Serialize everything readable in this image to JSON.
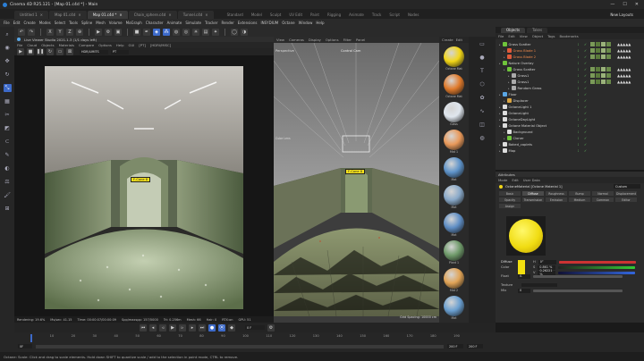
{
  "window": {
    "title": "Cinema 4D R25.121 - [Map 01.c4d *] - Main",
    "controls": [
      "—",
      "☐",
      "✕"
    ]
  },
  "doc_tabs": [
    {
      "label": "Untitled 1",
      "active": false
    },
    {
      "label": "Map 01.c4d",
      "active": false
    },
    {
      "label": "Map 01.c4d *",
      "active": true
    },
    {
      "label": "Chain_sphere.c4d",
      "active": false
    },
    {
      "label": "Tunnel.c4d",
      "active": false
    }
  ],
  "layouts": [
    "Standard",
    "Model",
    "Sculpt",
    "UV Edit",
    "Paint",
    "Rigging",
    "Animate",
    "Track",
    "Script",
    "Nodes"
  ],
  "new_layouts": "New Layouts",
  "menu": [
    "File",
    "Edit",
    "Create",
    "Modes",
    "Select",
    "Tools",
    "Spline",
    "Mesh",
    "Volume",
    "MoGraph",
    "Character",
    "Animate",
    "Simulate",
    "Tracker",
    "Render",
    "Extensions",
    "INSYDIUM",
    "Octane",
    "Window",
    "Help"
  ],
  "live_viewer": {
    "title": "Live Viewer Studio 2021.1.3 (1/1 days left)",
    "menu": [
      "File",
      "Cloud",
      "Objects",
      "Materials",
      "Compare",
      "Options",
      "Help",
      "GUI",
      "[PT]",
      "[HDRI/MISC]"
    ],
    "mode": "HDR/LIMITS",
    "mode2": "PT",
    "label": "F-Cone 8",
    "status": [
      "Rendering: 19.6%",
      "Ms/sec: 41.15",
      "Time: 00:00:07/00:00:09",
      "Spp/maxspp: 157/5000",
      "Tri: 0.256m",
      "Mesh: 66",
      "Hair: 0",
      "RTX:on",
      "GPU: 51"
    ]
  },
  "viewport": {
    "menu": [
      "View",
      "Cameras",
      "Display",
      "Options",
      "Filter",
      "Panel"
    ],
    "camera": "Perspective",
    "camera_name": "Control Cam",
    "label": "F-Cone 8",
    "grid": "Grid Spacing: 10000 cm",
    "side": "Cube Lens"
  },
  "materials": {
    "menu": [
      "Create",
      "Edit"
    ],
    "items": [
      {
        "name": "Octane Mat",
        "color": "#f2d617"
      },
      {
        "name": "Octane Mat",
        "color": "#e07a2b"
      },
      {
        "name": "Glass",
        "color": "#dfe6ee"
      },
      {
        "name": "Mat 1",
        "color": "#e9995a"
      },
      {
        "name": "Mat",
        "color": "#5e93c9"
      },
      {
        "name": "Mat",
        "color": "#89a9c9"
      },
      {
        "name": "Mat",
        "color": "#5f8ec5"
      },
      {
        "name": "Plant 1",
        "color": "#6f9a6a"
      },
      {
        "name": "Mat 2",
        "color": "#e0a356"
      },
      {
        "name": "Mat",
        "color": "#6a9fd0"
      },
      {
        "name": "Mat",
        "color": "#8ab1d7"
      }
    ]
  },
  "objects": {
    "tabs": [
      "Objects",
      "Takes"
    ],
    "menu": [
      "File",
      "Edit",
      "View",
      "Object",
      "Tags",
      "Bookmarks"
    ],
    "items": [
      {
        "name": "Grass Scatter",
        "indent": 0,
        "color": "#6fc43b",
        "thumbs": true
      },
      {
        "name": "Grass Blade 1",
        "indent": 1,
        "color": "#e05a3a",
        "thumbs": true
      },
      {
        "name": "Grass Blade 2",
        "indent": 1,
        "color": "#e05a3a",
        "thumbs": true
      },
      {
        "name": "Nature Overlay",
        "indent": 0,
        "color": "#6fc43b",
        "thumbs": false
      },
      {
        "name": "Grass Scatter",
        "indent": 1,
        "color": "#6fc43b",
        "thumbs": true
      },
      {
        "name": "Grass1",
        "indent": 2,
        "color": "#aaaaaa",
        "thumbs": true
      },
      {
        "name": "Grass1",
        "indent": 2,
        "color": "#aaaaaa",
        "thumbs": true
      },
      {
        "name": "Random Grass",
        "indent": 2,
        "color": "#aaaaaa",
        "thumbs": false
      },
      {
        "name": "Floor",
        "indent": 0,
        "color": "#5aa7e6",
        "thumbs": false
      },
      {
        "name": "Displacer",
        "indent": 1,
        "color": "#d9a441",
        "thumbs": false
      },
      {
        "name": "OctaneLight 1",
        "indent": 0,
        "color": "#dddddd",
        "thumbs": false
      },
      {
        "name": "OctaneLight",
        "indent": 0,
        "color": "#dddddd",
        "thumbs": false
      },
      {
        "name": "OctaneDayLight",
        "indent": 0,
        "color": "#dddddd",
        "thumbs": false
      },
      {
        "name": "Octane Material Object",
        "indent": 0,
        "color": "#dddddd",
        "thumbs": false
      },
      {
        "name": "Background",
        "indent": 1,
        "color": "#dddddd",
        "thumbs": false
      },
      {
        "name": "Cloner",
        "indent": 1,
        "color": "#6fc43b",
        "thumbs": false
      },
      {
        "name": "Baked_caplets",
        "indent": 0,
        "color": "#dddddd",
        "thumbs": false
      },
      {
        "name": "Map",
        "indent": 0,
        "color": "#dddddd",
        "thumbs": false
      }
    ]
  },
  "attributes": {
    "title": "Attributes",
    "menu": [
      "Mode",
      "Edit",
      "User Data"
    ],
    "material": "OctaneMaterial [Octane Material 1]",
    "preset": "Custom",
    "tabs": [
      "Basic",
      "Diffuse",
      "Roughness",
      "Bump",
      "Normal",
      "Displacement",
      "Opacity",
      "Transmission",
      "Emission",
      "Medium",
      "Common",
      "Editor",
      "Assign"
    ],
    "active_tab": "Diffuse",
    "section": "Diffuse",
    "color_label": "Color",
    "H": "H",
    "S": "S",
    "V": "V",
    "h_val": "0°",
    "s_val": "0.861 %",
    "v_val": "0.26221 %",
    "float_label": "Float",
    "float_val": "0.",
    "texture_label": "Texture",
    "mix_label": "Mix",
    "mix_val": "0"
  },
  "timeline": {
    "ticks": [
      "0",
      "10",
      "20",
      "30",
      "40",
      "50",
      "60",
      "70",
      "80",
      "90",
      "100",
      "110",
      "120",
      "130",
      "140",
      "150",
      "160",
      "170",
      "180",
      "190"
    ],
    "start": "0F",
    "end": "200 F",
    "current": "0 F",
    "fps": "200 F"
  },
  "status_bar": "Octane:     Scale: Click and drag to scale elements. Hold down SHIFT to quantize scale / add to the selection in point mode, CTRL to remove."
}
